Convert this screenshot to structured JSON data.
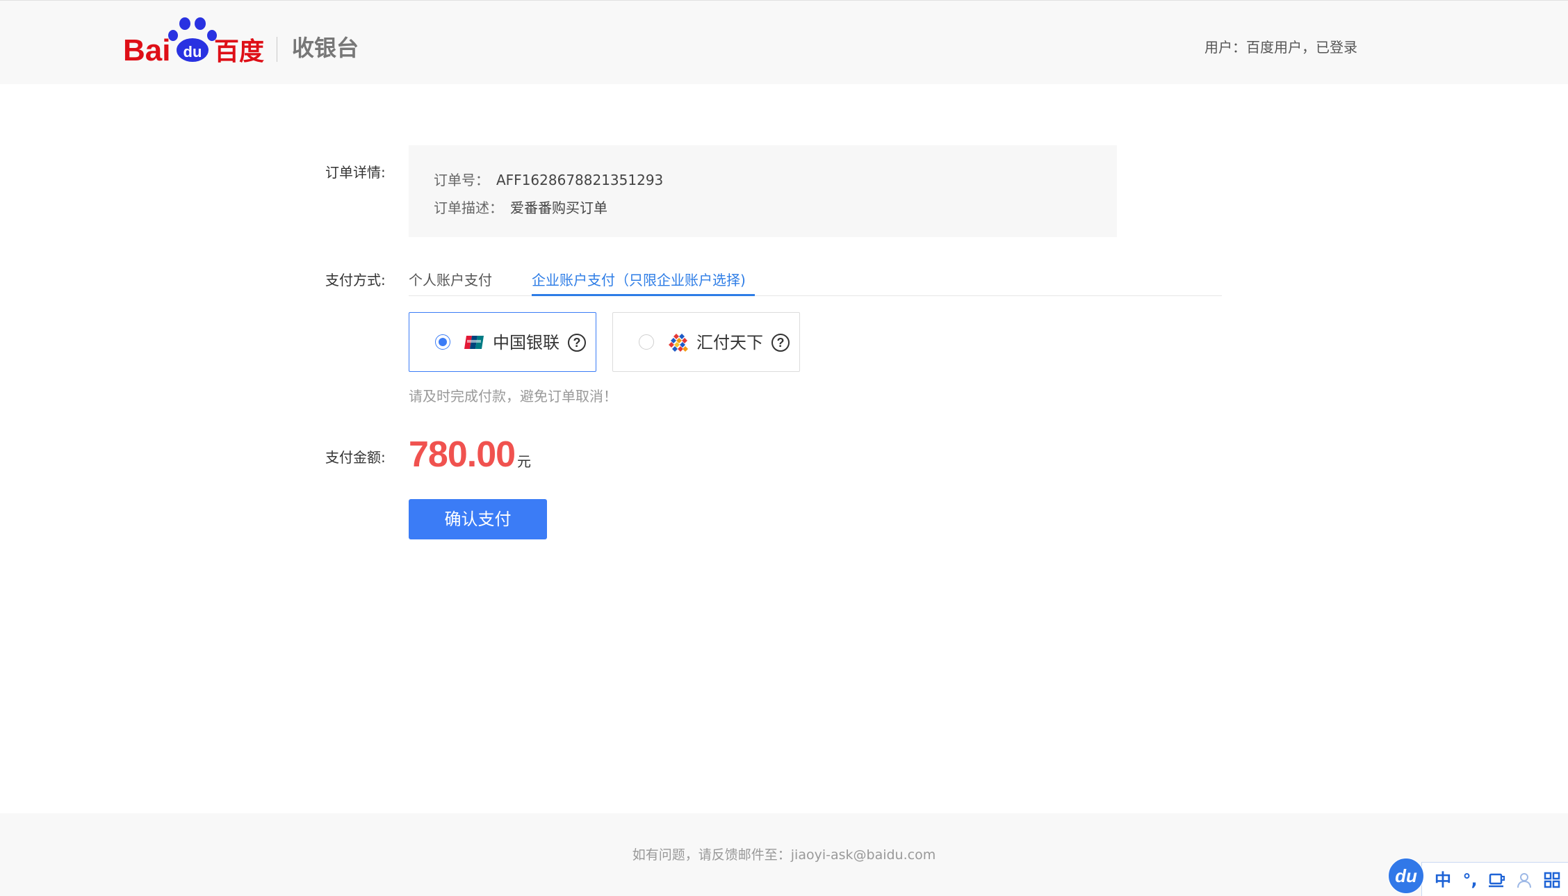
{
  "header": {
    "logo": {
      "latin": "Bai",
      "paw_text": "du",
      "cn": "百度"
    },
    "app_title": "收银台",
    "user_status": "用户：百度用户，已登录"
  },
  "order": {
    "section_label": "订单详情:",
    "number": {
      "label": "订单号：",
      "value": "AFF1628678821351293"
    },
    "description": {
      "label": "订单描述：",
      "value": "爱番番购买订单"
    }
  },
  "payment": {
    "section_label": "支付方式:",
    "tabs": [
      {
        "label": "个人账户支付",
        "active": false
      },
      {
        "label": "企业账户支付（只限企业账户选择)",
        "active": true
      }
    ],
    "methods": [
      {
        "name": "中国银联",
        "icon": "unionpay-icon",
        "selected": true,
        "help": "?"
      },
      {
        "name": "汇付天下",
        "icon": "chinapnr-icon",
        "selected": false,
        "help": "?"
      }
    ],
    "notice": "请及时完成付款，避免订单取消！"
  },
  "amount": {
    "label": "支付金额:",
    "value": "780.00",
    "unit": "元"
  },
  "actions": {
    "confirm_label": "确认支付"
  },
  "footer": {
    "contact_text": "如有问题，请反馈邮件至：jiaoyi-ask@baidu.com"
  },
  "ime_toolbar": {
    "logo_text": "du",
    "mode": "中",
    "punctuation": "°,",
    "icons": [
      "keyboard-icon",
      "user-icon",
      "toolbox-icon"
    ]
  },
  "colors": {
    "accent": "#3b7cf6",
    "price": "#f0524f",
    "baidu_red": "#de0f17",
    "baidu_blue": "#2932e1",
    "link_blue": "#2e7de6"
  }
}
